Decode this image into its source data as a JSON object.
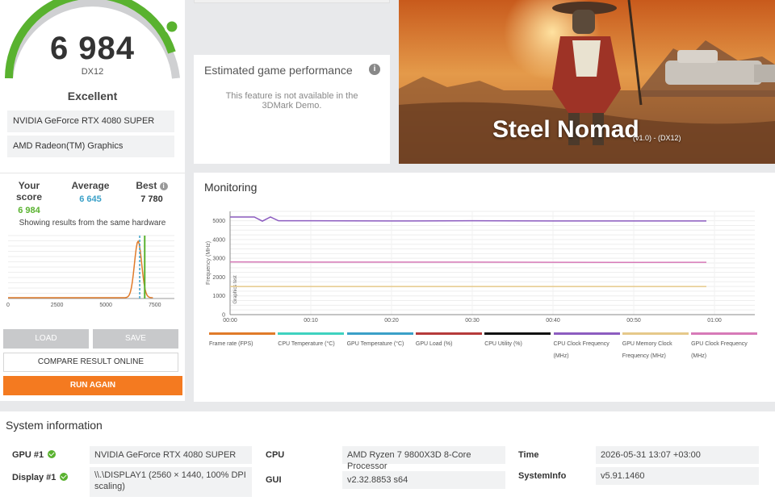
{
  "score": {
    "value": "6 984",
    "api": "DX12",
    "rating": "Excellent",
    "gauge_fraction": 0.9,
    "color": "#59b22f"
  },
  "hardware": {
    "gpu": "NVIDIA GeForce RTX 4080 SUPER",
    "igpu": "AMD Radeon(TM) Graphics"
  },
  "scores": {
    "yours_label": "Your score",
    "yours_value": "6 984",
    "average_label": "Average",
    "average_value": "6 645",
    "best_label": "Best",
    "best_value": "7 780"
  },
  "same_hardware_text": "Showing results from the same hardware",
  "distribution": {
    "x_ticks": [
      "0",
      "2500",
      "5000",
      "7500"
    ],
    "xlim": [
      0,
      8500
    ],
    "peak_x": 6645,
    "your_score_x": 6984,
    "average_x": 6645
  },
  "buttons": {
    "load": "LOAD",
    "save": "SAVE",
    "compare": "COMPARE RESULT ONLINE",
    "run": "RUN AGAIN"
  },
  "estimated": {
    "title": "Estimated game performance",
    "info_icon": "i",
    "text": "This feature is not available in the 3DMark Demo."
  },
  "banner": {
    "title": "Steel Nomad",
    "version": "(v1.0) - (DX12)"
  },
  "monitoring": {
    "title": "Monitoring",
    "y_label": "Frequency (MHz)",
    "y_label2": "Graphics test"
  },
  "chart_data": {
    "type": "line",
    "ylabel": "Frequency (MHz)",
    "ylim": [
      0,
      5500
    ],
    "y_ticks": [
      "0",
      "1000",
      "2000",
      "3000",
      "4000",
      "5000"
    ],
    "x_ticks": [
      "00:00",
      "00:10",
      "00:20",
      "00:30",
      "00:40",
      "00:50",
      "01:00"
    ],
    "xlim": [
      0,
      65
    ],
    "series": [
      {
        "name": "Frame rate (FPS)",
        "color": "#e07b2a",
        "x": [],
        "values": []
      },
      {
        "name": "CPU Temperature (°C)",
        "color": "#3fd2c0",
        "x": [],
        "values": []
      },
      {
        "name": "GPU Temperature (°C)",
        "color": "#3aa0c8",
        "x": [],
        "values": []
      },
      {
        "name": "GPU Load (%)",
        "color": "#b53a3a",
        "x": [],
        "values": []
      },
      {
        "name": "CPU Utility (%)",
        "color": "#111111",
        "x": [],
        "values": []
      },
      {
        "name": "CPU Clock Frequency (MHz)",
        "color": "#8c5cc0",
        "x": [
          0,
          3,
          4,
          5,
          6,
          10,
          20,
          30,
          40,
          50,
          59
        ],
        "values": [
          5200,
          5200,
          4980,
          5200,
          5000,
          5000,
          4990,
          5000,
          4990,
          4990,
          4990
        ]
      },
      {
        "name": "GPU Memory Clock Frequency (MHz)",
        "color": "#e6c98a",
        "x": [
          0,
          59
        ],
        "values": [
          1500,
          1500
        ]
      },
      {
        "name": "GPU Clock Frequency (MHz)",
        "color": "#d77ab8",
        "x": [
          0,
          10,
          20,
          30,
          40,
          50,
          59
        ],
        "values": [
          2810,
          2800,
          2800,
          2800,
          2790,
          2780,
          2790
        ]
      }
    ]
  },
  "system": {
    "title": "System information",
    "gpu_label": "GPU #1",
    "gpu_value": "NVIDIA GeForce RTX 4080 SUPER",
    "display_label": "Display #1",
    "display_value": "\\\\.\\DISPLAY1 (2560 × 1440, 100% DPI scaling)",
    "cpu_label": "CPU",
    "cpu_value": "AMD Ryzen 7 9800X3D 8-Core Processor",
    "gui_label": "GUI",
    "gui_value": "v2.32.8853 s64",
    "time_label": "Time",
    "time_value": "2026-05-31 13:07 +03:00",
    "sysinfo_label": "SystemInfo",
    "sysinfo_value": "v5.91.1460"
  }
}
